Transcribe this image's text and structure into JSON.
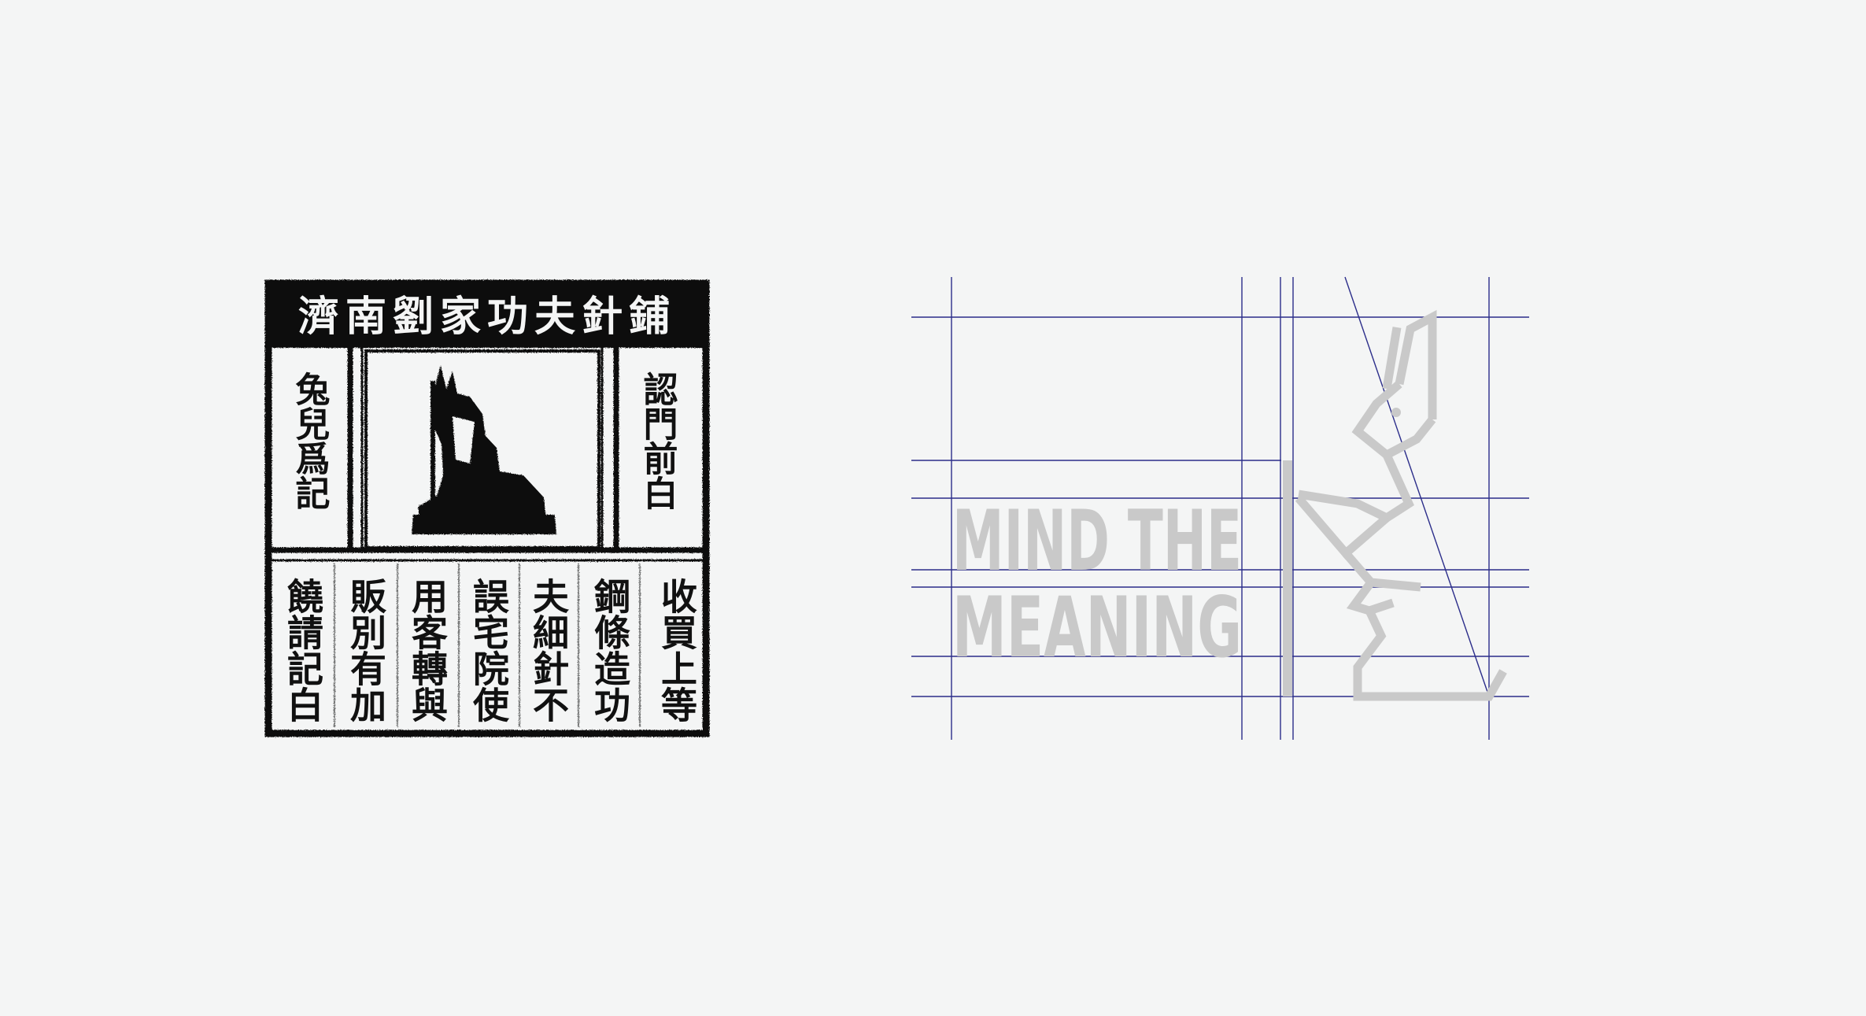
{
  "artwork": {
    "historical_print": {
      "subject": "Jinan Liu family needle shop advertisement woodblock with white rabbit emblem",
      "header_text": "濟南劉家功夫針鋪",
      "left_caption": "認門前白",
      "right_caption": "兔兒爲記",
      "body_text": "收買上等鋼條造功夫細針不誤宅院使用客轉與販別有加饒請記白"
    },
    "logo_construction": {
      "wordmark_line1": "MIND THE",
      "wordmark_line2": "MEANING",
      "emblem": "rabbit-icon",
      "grid_color": "#2b2d8a",
      "mark_color": "#c9c9c9"
    }
  }
}
